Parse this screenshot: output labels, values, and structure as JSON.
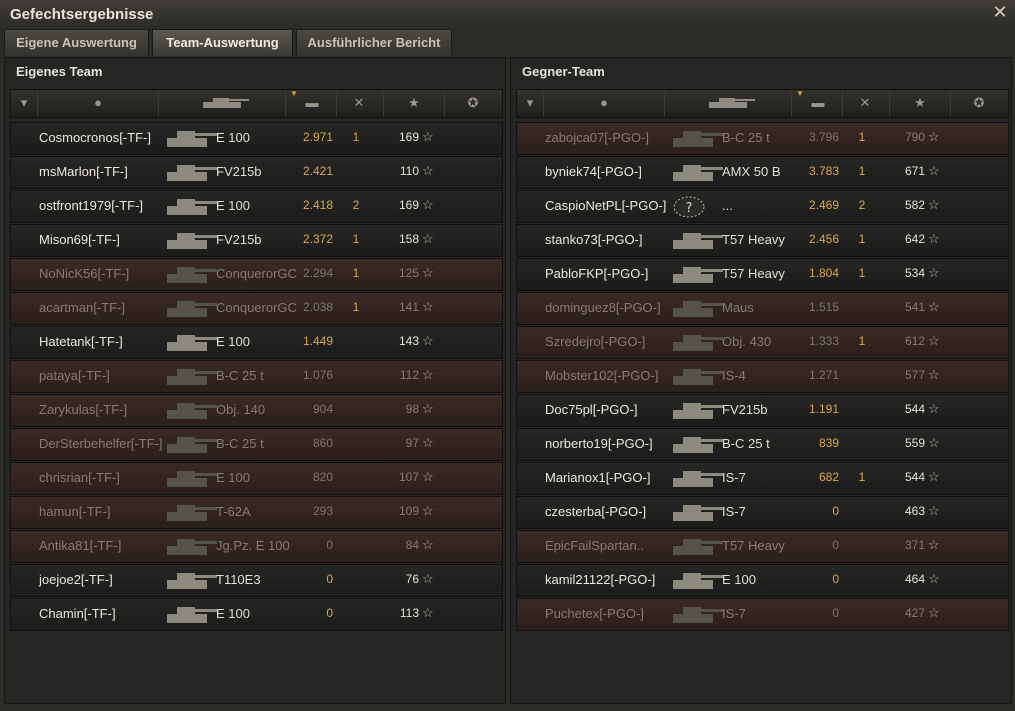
{
  "window": {
    "title": "Gefechtsergebnisse",
    "close_icon": "close-icon"
  },
  "tabs": [
    {
      "label": "Eigene Auswertung"
    },
    {
      "label": "Team-Auswertung"
    },
    {
      "label": "Ausführlicher Bericht"
    }
  ],
  "active_tab": "Team-Auswertung",
  "colors": {
    "damage": "#d8a94c",
    "dead_row": "#3a2a25",
    "accent": "#c9a24a"
  },
  "teams": {
    "own": {
      "title": "Eigenes Team",
      "rows": [
        {
          "name": "Cosmocronos[-TF-]",
          "tank": "E 100",
          "damage": "2.971",
          "kills": "1",
          "xp": "169",
          "dead": false
        },
        {
          "name": "msMarlon[-TF-]",
          "tank": "FV215b",
          "damage": "2.421",
          "kills": "",
          "xp": "110",
          "dead": false
        },
        {
          "name": "ostfront1979[-TF-]",
          "tank": "E 100",
          "damage": "2.418",
          "kills": "2",
          "xp": "169",
          "dead": false
        },
        {
          "name": "Mison69[-TF-]",
          "tank": "FV215b",
          "damage": "2.372",
          "kills": "1",
          "xp": "158",
          "dead": false
        },
        {
          "name": "NoNicK56[-TF-]",
          "tank": "ConquerorGC",
          "damage": "2.294",
          "kills": "1",
          "xp": "125",
          "dead": true
        },
        {
          "name": "acartman[-TF-]",
          "tank": "ConquerorGC",
          "damage": "2.038",
          "kills": "1",
          "xp": "141",
          "dead": true
        },
        {
          "name": "Hatetank[-TF-]",
          "tank": "E 100",
          "damage": "1.449",
          "kills": "",
          "xp": "143",
          "dead": false
        },
        {
          "name": "pataya[-TF-]",
          "tank": "B-C 25 t",
          "damage": "1.076",
          "kills": "",
          "xp": "112",
          "dead": true
        },
        {
          "name": "Zarykulas[-TF-]",
          "tank": "Obj. 140",
          "damage": "904",
          "kills": "",
          "xp": "98",
          "dead": true
        },
        {
          "name": "DerSterbehelfer[-TF-]",
          "tank": "B-C 25 t",
          "damage": "860",
          "kills": "",
          "xp": "97",
          "dead": true
        },
        {
          "name": "chrisrian[-TF-]",
          "tank": "E 100",
          "damage": "820",
          "kills": "",
          "xp": "107",
          "dead": true
        },
        {
          "name": "hamun[-TF-]",
          "tank": "T-62A",
          "damage": "293",
          "kills": "",
          "xp": "109",
          "dead": true
        },
        {
          "name": "Antika81[-TF-]",
          "tank": "Jg.Pz. E 100",
          "damage": "0",
          "kills": "",
          "xp": "84",
          "dead": true
        },
        {
          "name": "joejoe2[-TF-]",
          "tank": "T110E3",
          "damage": "0",
          "kills": "",
          "xp": "76",
          "dead": false
        },
        {
          "name": "Chamin[-TF-]",
          "tank": "E 100",
          "damage": "0",
          "kills": "",
          "xp": "113",
          "dead": false
        }
      ]
    },
    "enemy": {
      "title": "Gegner-Team",
      "rows": [
        {
          "name": "zabojca07[-PGO-]",
          "tank": "B-C 25 t",
          "damage": "3.796",
          "kills": "1",
          "xp": "790",
          "dead": true
        },
        {
          "name": "byniek74[-PGO-]",
          "tank": "AMX 50 B",
          "damage": "3.783",
          "kills": "1",
          "xp": "671",
          "dead": false
        },
        {
          "name": "CaspioNetPL[-PGO-]",
          "tank": "...",
          "damage": "2.469",
          "kills": "2",
          "xp": "582",
          "dead": false,
          "unknown": true
        },
        {
          "name": "stanko73[-PGO-]",
          "tank": "T57 Heavy",
          "damage": "2.456",
          "kills": "1",
          "xp": "642",
          "dead": false
        },
        {
          "name": "PabloFKP[-PGO-]",
          "tank": "T57 Heavy",
          "damage": "1.804",
          "kills": "1",
          "xp": "534",
          "dead": false
        },
        {
          "name": "dominguez8[-PGO-]",
          "tank": "Maus",
          "damage": "1.515",
          "kills": "",
          "xp": "541",
          "dead": true
        },
        {
          "name": "Szredejro[-PGO-]",
          "tank": "Obj. 430",
          "damage": "1.333",
          "kills": "1",
          "xp": "612",
          "dead": true
        },
        {
          "name": "Mobster102[-PGO-]",
          "tank": "IS-4",
          "damage": "1.271",
          "kills": "",
          "xp": "577",
          "dead": true
        },
        {
          "name": "Doc75pl[-PGO-]",
          "tank": "FV215b",
          "damage": "1.191",
          "kills": "",
          "xp": "544",
          "dead": false
        },
        {
          "name": "norberto19[-PGO-]",
          "tank": "B-C 25 t",
          "damage": "839",
          "kills": "",
          "xp": "559",
          "dead": false
        },
        {
          "name": "Marianox1[-PGO-]",
          "tank": "IS-7",
          "damage": "682",
          "kills": "1",
          "xp": "544",
          "dead": false
        },
        {
          "name": "czesterba[-PGO-]",
          "tank": "IS-7",
          "damage": "0",
          "kills": "",
          "xp": "463",
          "dead": false
        },
        {
          "name": "EpicFailSpartan..",
          "tank": "T57 Heavy",
          "damage": "0",
          "kills": "",
          "xp": "371",
          "dead": true
        },
        {
          "name": "kamil21122[-PGO-]",
          "tank": "E 100",
          "damage": "0",
          "kills": "",
          "xp": "464",
          "dead": false
        },
        {
          "name": "Puchetex[-PGO-]",
          "tank": "IS-7",
          "damage": "0",
          "kills": "",
          "xp": "427",
          "dead": true
        }
      ]
    }
  }
}
